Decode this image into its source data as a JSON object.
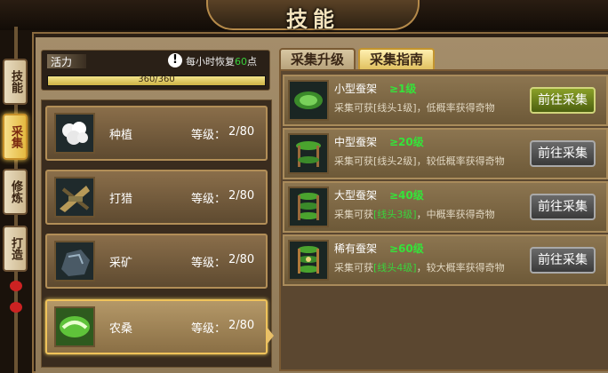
{
  "header": {
    "title": "技能"
  },
  "side_tabs": [
    {
      "label": "技能",
      "active": false
    },
    {
      "label": "采集",
      "active": true
    },
    {
      "label": "修炼",
      "active": false
    },
    {
      "label": "打造",
      "active": false
    }
  ],
  "vigor": {
    "label": "活力",
    "hint_prefix": "每小时恢复",
    "hint_value": "60",
    "hint_suffix": "点",
    "value_text": "360/360",
    "fill_fraction": 1.0
  },
  "skills": [
    {
      "name": "种植",
      "level_label": "等级：",
      "level": "2/80",
      "icon": "cotton-plant-icon"
    },
    {
      "name": "打猎",
      "level_label": "等级：",
      "level": "2/80",
      "icon": "hunting-gear-icon"
    },
    {
      "name": "采矿",
      "level_label": "等级：",
      "level": "2/80",
      "icon": "ore-rock-icon"
    },
    {
      "name": "农桑",
      "level_label": "等级：",
      "level": "2/80",
      "icon": "silkworm-leaf-icon",
      "active": true
    }
  ],
  "tabs": [
    {
      "label": "采集升级",
      "active": false
    },
    {
      "label": "采集指南",
      "active": true
    }
  ],
  "guides": [
    {
      "title": "小型蚕架",
      "requirement": "≥1级",
      "desc_prefix": "采集可获",
      "desc_item": "[线头1级]",
      "desc_suffix": "，低概率获得奇物",
      "button": "前往采集",
      "primary": true
    },
    {
      "title": "中型蚕架",
      "requirement": "≥20级",
      "desc_prefix": "采集可获",
      "desc_item": "[线头2级]",
      "desc_suffix": "，较低概率获得奇物",
      "button": "前往采集",
      "primary": false
    },
    {
      "title": "大型蚕架",
      "requirement": "≥40级",
      "desc_prefix": "采集可获",
      "desc_item": "[线头3级]",
      "desc_suffix": "，中概率获得奇物",
      "button": "前往采集",
      "primary": false
    },
    {
      "title": "稀有蚕架",
      "requirement": "≥60级",
      "desc_prefix": "采集可获",
      "desc_item": "[线头4级]",
      "desc_suffix": "，较大概率获得奇物",
      "button": "前往采集",
      "primary": false
    }
  ],
  "colors": {
    "accent_green": "#35e33a",
    "gold": "#e1c160"
  }
}
